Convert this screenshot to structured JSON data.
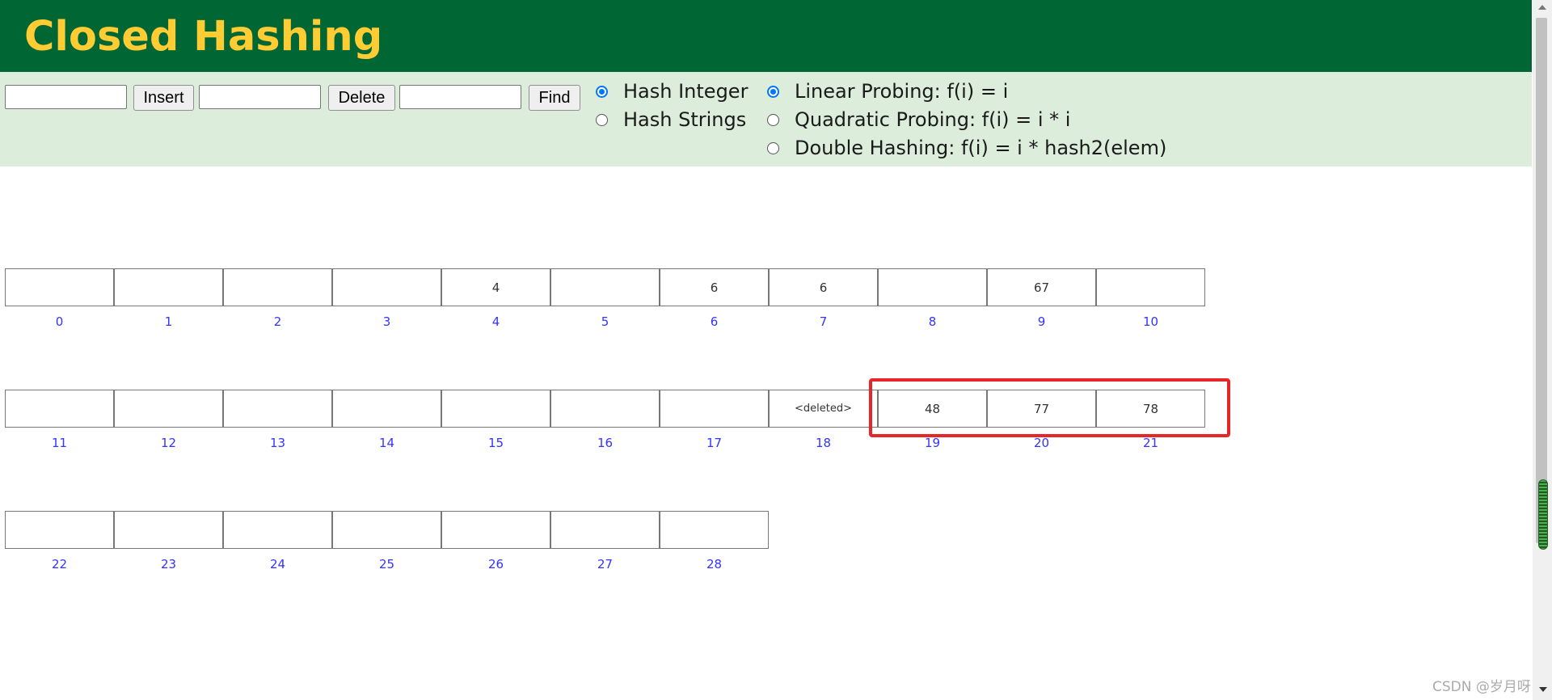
{
  "header": {
    "title": "Closed Hashing"
  },
  "controls": {
    "insert_input": {
      "value": ""
    },
    "insert_button": "Insert",
    "delete_input": {
      "value": ""
    },
    "delete_button": "Delete",
    "find_input": {
      "value": ""
    },
    "find_button": "Find",
    "hash_type_options": [
      {
        "label": "Hash Integer",
        "checked": true
      },
      {
        "label": "Hash Strings",
        "checked": false
      }
    ],
    "probing_options": [
      {
        "label": "Linear Probing: f(i) = i",
        "checked": true
      },
      {
        "label": "Quadratic Probing: f(i) = i * i",
        "checked": false
      },
      {
        "label": "Double Hashing: f(i) = i * hash2(elem)",
        "checked": false
      }
    ]
  },
  "hash_table": {
    "cells": [
      {
        "index": "0",
        "value": ""
      },
      {
        "index": "1",
        "value": ""
      },
      {
        "index": "2",
        "value": ""
      },
      {
        "index": "3",
        "value": ""
      },
      {
        "index": "4",
        "value": "4"
      },
      {
        "index": "5",
        "value": ""
      },
      {
        "index": "6",
        "value": "6"
      },
      {
        "index": "7",
        "value": "6"
      },
      {
        "index": "8",
        "value": ""
      },
      {
        "index": "9",
        "value": "67"
      },
      {
        "index": "10",
        "value": ""
      },
      {
        "index": "11",
        "value": ""
      },
      {
        "index": "12",
        "value": ""
      },
      {
        "index": "13",
        "value": ""
      },
      {
        "index": "14",
        "value": ""
      },
      {
        "index": "15",
        "value": ""
      },
      {
        "index": "16",
        "value": ""
      },
      {
        "index": "17",
        "value": ""
      },
      {
        "index": "18",
        "value": "<deleted>"
      },
      {
        "index": "19",
        "value": "48"
      },
      {
        "index": "20",
        "value": "77"
      },
      {
        "index": "21",
        "value": "78"
      },
      {
        "index": "22",
        "value": ""
      },
      {
        "index": "23",
        "value": ""
      },
      {
        "index": "24",
        "value": ""
      },
      {
        "index": "25",
        "value": ""
      },
      {
        "index": "26",
        "value": ""
      },
      {
        "index": "27",
        "value": ""
      },
      {
        "index": "28",
        "value": ""
      }
    ],
    "highlighted_indices": [
      "19",
      "20",
      "21"
    ]
  },
  "watermark": "CSDN @岁月呀",
  "colors": {
    "header_bg": "#006633",
    "title_text": "#FFCC33",
    "controls_bg": "#DCEDDC",
    "index_label": "#3333FF",
    "highlight_border": "#E8262A",
    "radio_checked": "#0075FF"
  }
}
